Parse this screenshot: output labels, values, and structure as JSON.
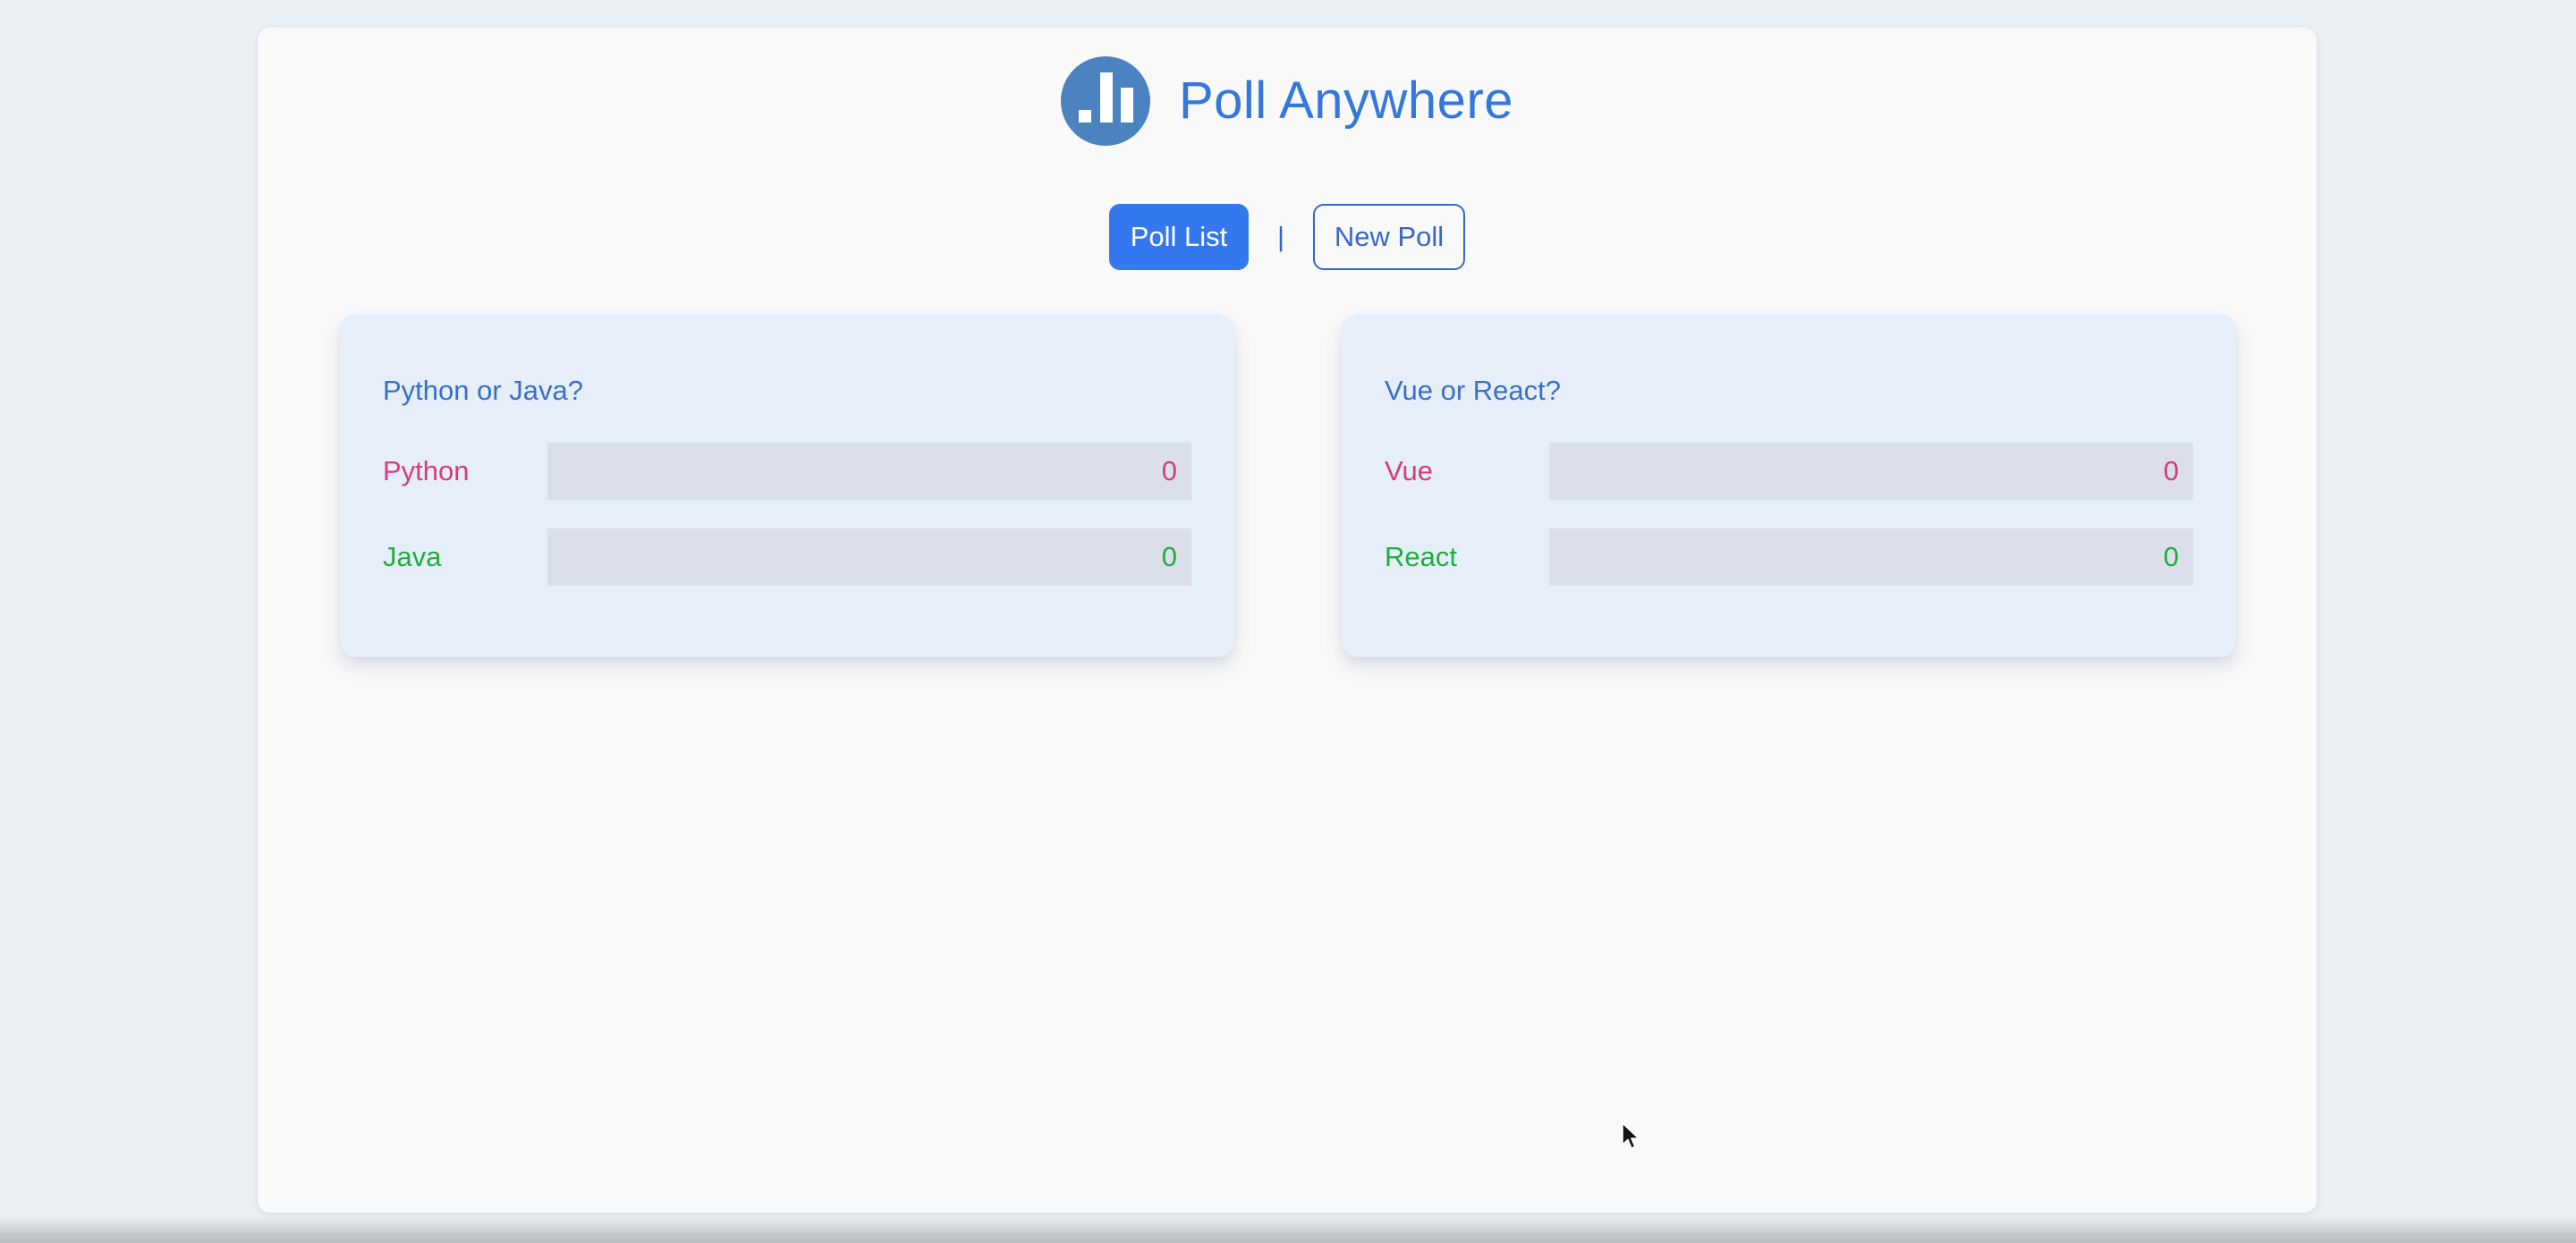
{
  "app": {
    "title": "Poll Anywhere",
    "logo_icon": "bar-chart-icon"
  },
  "nav": {
    "items": [
      {
        "label": "Poll List",
        "active": true
      },
      {
        "label": "New Poll",
        "active": false
      }
    ],
    "separator": "|"
  },
  "polls": [
    {
      "question": "Python or Java?",
      "options": [
        {
          "label": "Python",
          "count": "0",
          "share": 0,
          "color": "#d63c7e"
        },
        {
          "label": "Java",
          "count": "0",
          "share": 0,
          "color": "#1fae3c"
        }
      ]
    },
    {
      "question": "Vue or React?",
      "options": [
        {
          "label": "Vue",
          "count": "0",
          "share": 0,
          "color": "#d63c7e"
        },
        {
          "label": "React",
          "count": "0",
          "share": 0,
          "color": "#1fae3c"
        }
      ]
    }
  ],
  "colors": {
    "primary": "#3478f0",
    "title": "#3478dc",
    "logo_bg": "#4a83c0",
    "card_bg": "#e6eef9",
    "bar_track": "#dadfe9"
  }
}
